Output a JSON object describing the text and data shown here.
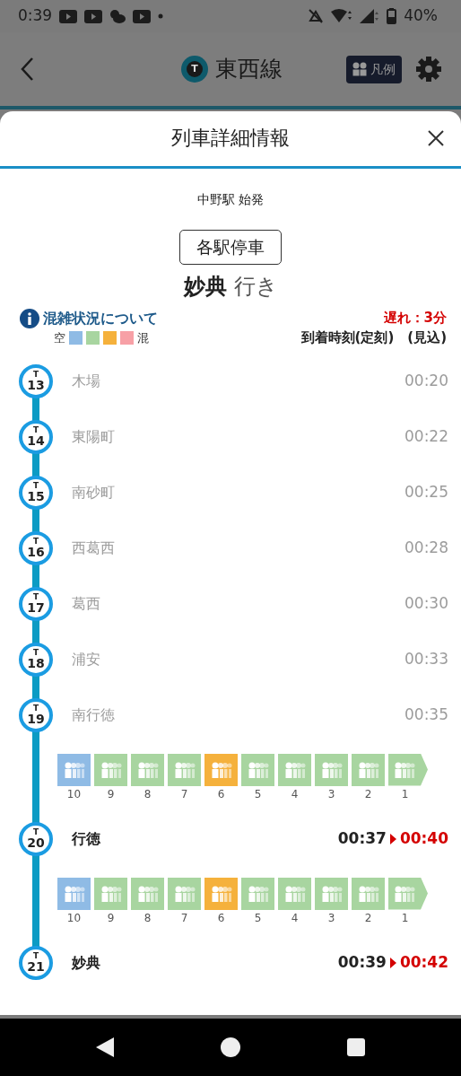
{
  "status_bar": {
    "time": "0:39",
    "battery": "40%"
  },
  "header": {
    "line_letter": "T",
    "title": "東西線",
    "legend_button": "凡例"
  },
  "sheet": {
    "title": "列車詳細情報"
  },
  "train": {
    "origin": "中野駅 始発",
    "type": "各駅停車",
    "destination": "妙典",
    "destination_suffix": "行き"
  },
  "congestion_info": {
    "link": "混雑状況について",
    "low_label": "空",
    "levels": [
      {
        "color": "#8fbbe5"
      },
      {
        "color": "#a8d5a0"
      },
      {
        "color": "#f5b13c"
      },
      {
        "color": "#f7a0a6"
      }
    ],
    "high_label": "混"
  },
  "delay": "遅れ：3分",
  "time_header": "到着時刻(定刻)　(見込)",
  "stops": [
    {
      "kind": "station",
      "letter": "T",
      "number": "13",
      "name": "木場",
      "passed": true,
      "scheduled": "00:20"
    },
    {
      "kind": "station",
      "letter": "T",
      "number": "14",
      "name": "東陽町",
      "passed": true,
      "scheduled": "00:22"
    },
    {
      "kind": "station",
      "letter": "T",
      "number": "15",
      "name": "南砂町",
      "passed": true,
      "scheduled": "00:25"
    },
    {
      "kind": "station",
      "letter": "T",
      "number": "16",
      "name": "西葛西",
      "passed": true,
      "scheduled": "00:28"
    },
    {
      "kind": "station",
      "letter": "T",
      "number": "17",
      "name": "葛西",
      "passed": true,
      "scheduled": "00:30"
    },
    {
      "kind": "station",
      "letter": "T",
      "number": "18",
      "name": "浦安",
      "passed": true,
      "scheduled": "00:33"
    },
    {
      "kind": "station",
      "letter": "T",
      "number": "19",
      "name": "南行徳",
      "passed": true,
      "scheduled": "00:35"
    },
    {
      "kind": "train",
      "cars": [
        {
          "number": "10",
          "color": "#8fbbe5"
        },
        {
          "number": "9",
          "color": "#a8d5a0"
        },
        {
          "number": "8",
          "color": "#a8d5a0"
        },
        {
          "number": "7",
          "color": "#a8d5a0"
        },
        {
          "number": "6",
          "color": "#f5b13c"
        },
        {
          "number": "5",
          "color": "#a8d5a0"
        },
        {
          "number": "4",
          "color": "#a8d5a0"
        },
        {
          "number": "3",
          "color": "#a8d5a0"
        },
        {
          "number": "2",
          "color": "#a8d5a0"
        },
        {
          "number": "1",
          "color": "#a8d5a0"
        }
      ]
    },
    {
      "kind": "station",
      "letter": "T",
      "number": "20",
      "name": "行徳",
      "passed": false,
      "scheduled": "00:37",
      "expected": "00:40"
    },
    {
      "kind": "train",
      "cars": [
        {
          "number": "10",
          "color": "#8fbbe5"
        },
        {
          "number": "9",
          "color": "#a8d5a0"
        },
        {
          "number": "8",
          "color": "#a8d5a0"
        },
        {
          "number": "7",
          "color": "#a8d5a0"
        },
        {
          "number": "6",
          "color": "#f5b13c"
        },
        {
          "number": "5",
          "color": "#a8d5a0"
        },
        {
          "number": "4",
          "color": "#a8d5a0"
        },
        {
          "number": "3",
          "color": "#a8d5a0"
        },
        {
          "number": "2",
          "color": "#a8d5a0"
        },
        {
          "number": "1",
          "color": "#a8d5a0"
        }
      ]
    },
    {
      "kind": "station",
      "letter": "T",
      "number": "21",
      "name": "妙典",
      "passed": false,
      "scheduled": "00:39",
      "expected": "00:42"
    }
  ]
}
